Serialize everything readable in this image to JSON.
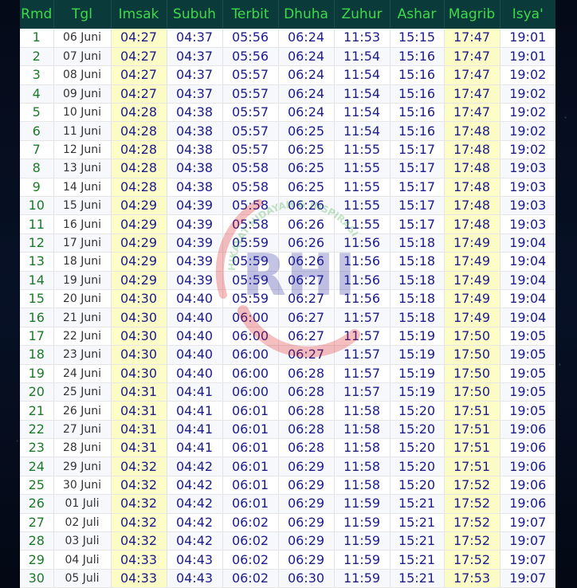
{
  "header": {
    "columns": [
      "Rmd",
      "Tgl",
      "Imsak",
      "Subuh",
      "Terbit",
      "Dhuha",
      "Zuhur",
      "Ashar",
      "Magrib",
      "Isya'"
    ]
  },
  "rows": [
    [
      "1",
      "06 Juni",
      "04:27",
      "04:37",
      "05:56",
      "06:24",
      "11:53",
      "15:15",
      "17:47",
      "19:01"
    ],
    [
      "2",
      "07 Juni",
      "04:27",
      "04:37",
      "05:56",
      "06:24",
      "11:54",
      "15:16",
      "17:47",
      "19:01"
    ],
    [
      "3",
      "08 Juni",
      "04:27",
      "04:37",
      "05:57",
      "06:24",
      "11:54",
      "15:16",
      "17:47",
      "19:02"
    ],
    [
      "4",
      "09 Juni",
      "04:27",
      "04:37",
      "05:57",
      "06:24",
      "11:54",
      "15:16",
      "17:47",
      "19:02"
    ],
    [
      "5",
      "10 Juni",
      "04:28",
      "04:38",
      "05:57",
      "06:24",
      "11:54",
      "15:16",
      "17:47",
      "19:02"
    ],
    [
      "6",
      "11 Juni",
      "04:28",
      "04:38",
      "05:57",
      "06:25",
      "11:54",
      "15:16",
      "17:48",
      "19:02"
    ],
    [
      "7",
      "12 Juni",
      "04:28",
      "04:38",
      "05:57",
      "06:25",
      "11:55",
      "15:17",
      "17:48",
      "19:02"
    ],
    [
      "8",
      "13 Juni",
      "04:28",
      "04:38",
      "05:58",
      "06:25",
      "11:55",
      "15:17",
      "17:48",
      "19:03"
    ],
    [
      "9",
      "14 Juni",
      "04:28",
      "04:38",
      "05:58",
      "06:25",
      "11:55",
      "15:17",
      "17:48",
      "19:03"
    ],
    [
      "10",
      "15 Juni",
      "04:29",
      "04:39",
      "05:58",
      "06:26",
      "11:55",
      "15:17",
      "17:48",
      "19:03"
    ],
    [
      "11",
      "16 Juni",
      "04:29",
      "04:39",
      "05:58",
      "06:26",
      "11:55",
      "15:17",
      "17:48",
      "19:03"
    ],
    [
      "12",
      "17 Juni",
      "04:29",
      "04:39",
      "05:59",
      "06:26",
      "11:56",
      "15:18",
      "17:49",
      "19:04"
    ],
    [
      "13",
      "18 Juni",
      "04:29",
      "04:39",
      "05:59",
      "06:26",
      "11:56",
      "15:18",
      "17:49",
      "19:04"
    ],
    [
      "14",
      "19 Juni",
      "04:29",
      "04:39",
      "05:59",
      "06:27",
      "11:56",
      "15:18",
      "17:49",
      "19:04"
    ],
    [
      "15",
      "20 Juni",
      "04:30",
      "04:40",
      "05:59",
      "06:27",
      "11:56",
      "15:18",
      "17:49",
      "19:04"
    ],
    [
      "16",
      "21 Juni",
      "04:30",
      "04:40",
      "06:00",
      "06:27",
      "11:57",
      "15:18",
      "17:49",
      "19:04"
    ],
    [
      "17",
      "22 Juni",
      "04:30",
      "04:40",
      "06:00",
      "06:27",
      "11:57",
      "15:19",
      "17:50",
      "19:05"
    ],
    [
      "18",
      "23 Juni",
      "04:30",
      "04:40",
      "06:00",
      "06:27",
      "11:57",
      "15:19",
      "17:50",
      "19:05"
    ],
    [
      "19",
      "24 Juni",
      "04:30",
      "04:40",
      "06:00",
      "06:28",
      "11:57",
      "15:19",
      "17:50",
      "19:05"
    ],
    [
      "20",
      "25 Juni",
      "04:31",
      "04:41",
      "06:00",
      "06:28",
      "11:57",
      "15:19",
      "17:50",
      "19:05"
    ],
    [
      "21",
      "26 Juni",
      "04:31",
      "04:41",
      "06:01",
      "06:28",
      "11:58",
      "15:20",
      "17:51",
      "19:05"
    ],
    [
      "22",
      "27 Juni",
      "04:31",
      "04:41",
      "06:01",
      "06:28",
      "11:58",
      "15:20",
      "17:51",
      "19:06"
    ],
    [
      "23",
      "28 Juni",
      "04:31",
      "04:41",
      "06:01",
      "06:28",
      "11:58",
      "15:20",
      "17:51",
      "19:06"
    ],
    [
      "24",
      "29 Juni",
      "04:32",
      "04:42",
      "06:01",
      "06:29",
      "11:58",
      "15:20",
      "17:51",
      "19:06"
    ],
    [
      "25",
      "30 Juni",
      "04:32",
      "04:42",
      "06:01",
      "06:29",
      "11:58",
      "15:20",
      "17:52",
      "19:06"
    ],
    [
      "26",
      "01 Juli",
      "04:32",
      "04:42",
      "06:01",
      "06:29",
      "11:59",
      "15:21",
      "17:52",
      "19:06"
    ],
    [
      "27",
      "02 Juli",
      "04:32",
      "04:42",
      "06:02",
      "06:29",
      "11:59",
      "15:21",
      "17:52",
      "19:07"
    ],
    [
      "28",
      "03 Juli",
      "04:32",
      "04:42",
      "06:02",
      "06:29",
      "11:59",
      "15:21",
      "17:52",
      "19:07"
    ],
    [
      "29",
      "04 Juli",
      "04:33",
      "04:43",
      "06:02",
      "06:29",
      "11:59",
      "15:21",
      "17:52",
      "19:07"
    ],
    [
      "30",
      "05 Juli",
      "04:33",
      "04:43",
      "06:02",
      "06:30",
      "11:59",
      "15:21",
      "17:53",
      "19:07"
    ]
  ],
  "watermark": {
    "logo_text": "RHI",
    "arc_text": "HIKAYAT HIDAYAH & INSPIRASI"
  },
  "colors": {
    "header_bg": "#0b3a3a",
    "header_text": "#3fd94a",
    "time_text": "#1c1c8a",
    "rmd_text": "#1d7a2a",
    "highlight_column": "#fdfdc8"
  }
}
